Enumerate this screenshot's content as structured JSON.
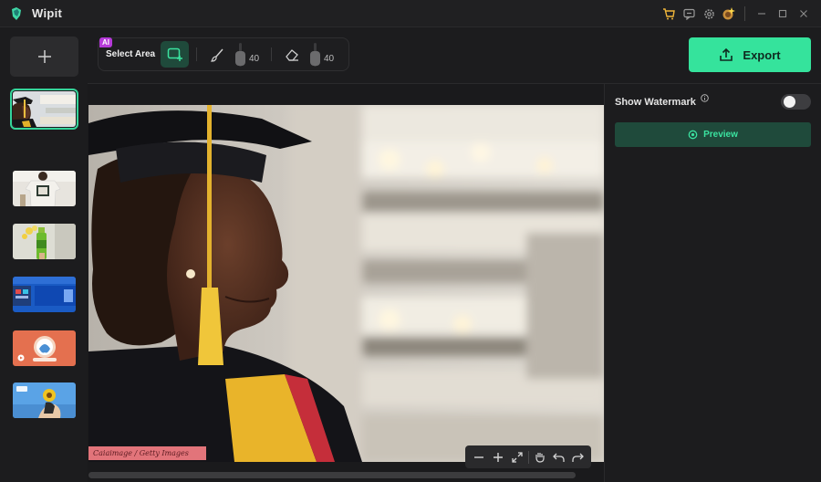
{
  "app": {
    "title": "Wipit"
  },
  "titlebar": {
    "icons": [
      "cart-icon",
      "feedback-icon",
      "settings-icon",
      "premium-icon"
    ],
    "window_controls": [
      "minimize-icon",
      "maximize-icon",
      "close-icon"
    ]
  },
  "sidebar": {
    "add_icon": "plus-icon",
    "thumbnails": [
      {
        "name": "graduate portrait",
        "active": true
      },
      {
        "name": "shirt back",
        "active": false
      },
      {
        "name": "green bottle",
        "active": false
      },
      {
        "name": "blue design",
        "active": false
      },
      {
        "name": "orange promo",
        "active": false
      },
      {
        "name": "sunflower",
        "active": false
      }
    ]
  },
  "toolbar": {
    "ai_badge": "AI",
    "select_area_label": "Select Area",
    "brush_size": "40",
    "eraser_size": "40",
    "export_label": "Export"
  },
  "canvas": {
    "watermark_text": "Caiaimage / Getty Images",
    "zoom_controls": [
      "zoom-out-icon",
      "zoom-in-icon",
      "fit-icon",
      "hand-icon",
      "undo-icon",
      "redo-icon"
    ]
  },
  "right_panel": {
    "show_watermark_label": "Show Watermark",
    "show_watermark_on": false,
    "preview_label": "Preview"
  },
  "colors": {
    "accent": "#35e39c",
    "accent_dark": "#1f4a3b",
    "background": "#1c1c1e",
    "watermark_bg": "#e2747a"
  }
}
